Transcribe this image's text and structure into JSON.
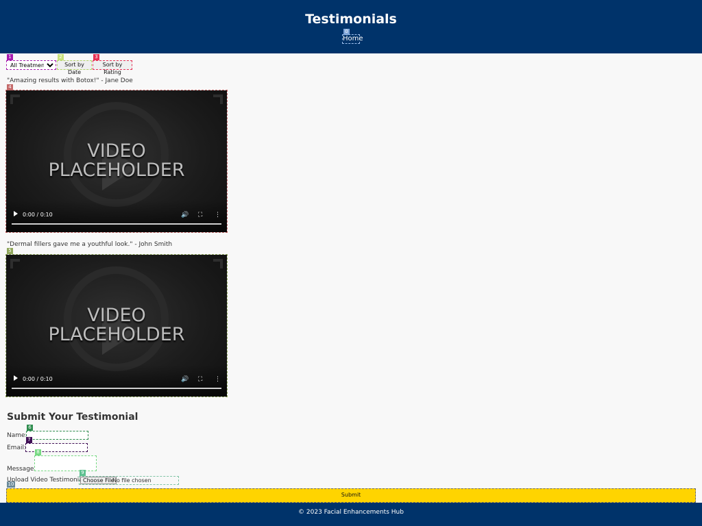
{
  "header": {
    "title": "Testimonials",
    "nav_home": "Home"
  },
  "tags": [
    "0",
    "1",
    "2",
    "3",
    "4",
    "5",
    "6",
    "7",
    "8",
    "9",
    "10"
  ],
  "controls": {
    "treatment_select": {
      "selected": "All Treatments"
    },
    "sort_date_label": "Sort by Date",
    "sort_rating_label": "Sort by Rating"
  },
  "testimonials": [
    {
      "quote": "\"Amazing results with Botox!\" - Jane Doe",
      "placeholder_line1": "VIDEO",
      "placeholder_line2": "PLACEHOLDER",
      "time": "0:00 / 0:10"
    },
    {
      "quote": "\"Dermal fillers gave me a youthful look.\" - John Smith",
      "placeholder_line1": "VIDEO",
      "placeholder_line2": "PLACEHOLDER",
      "time": "0:00 / 0:10"
    }
  ],
  "form": {
    "title": "Submit Your Testimonial",
    "name_label": "Name:",
    "email_label": "Email:",
    "message_label": "Message:",
    "upload_label": "Upload Video Testimonial:",
    "choose_file_label": "Choose File",
    "no_file_label": "No file chosen",
    "submit_label": "Submit"
  },
  "footer": {
    "text": "© 2023 Facial Enhancements Hub"
  },
  "colors": {
    "header_bg": "#00336a",
    "submit_bg": "#ffd400",
    "page_bg": "#f8f8f8"
  }
}
